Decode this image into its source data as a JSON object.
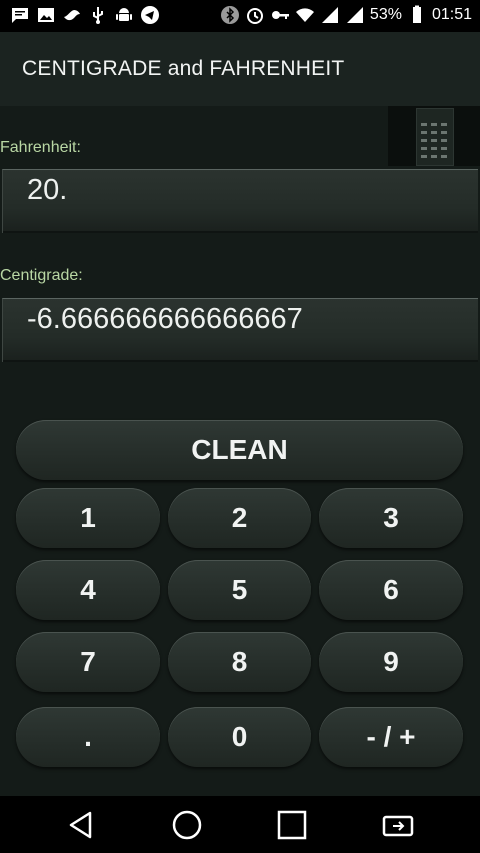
{
  "status_bar": {
    "battery_text": "53%",
    "time": "01:51",
    "left_icons": [
      "message-icon",
      "image-icon",
      "bird-icon",
      "usb-icon",
      "android-icon",
      "telegram-icon"
    ],
    "right_icons": [
      "bluetooth-icon",
      "alarm-icon",
      "key-icon",
      "wifi-icon",
      "signal-icon",
      "signal-icon",
      "battery-icon"
    ]
  },
  "app_bar": {
    "title": "CENTIGRADE and FAHRENHEIT"
  },
  "fahrenheit": {
    "label": "Fahrenheit:",
    "value": "20."
  },
  "centigrade": {
    "label": "Centigrade:",
    "value": "-6.666666666666667"
  },
  "keypad": {
    "clean": "CLEAN",
    "rows": [
      [
        "1",
        "2",
        "3"
      ],
      [
        "4",
        "5",
        "6"
      ],
      [
        "7",
        "8",
        "9"
      ],
      [
        ".",
        "0",
        "- / +"
      ]
    ]
  },
  "nav_bar": {
    "icons": [
      "back-icon",
      "home-icon",
      "recents-icon",
      "screen-rotate-icon"
    ]
  },
  "colors": {
    "background": "#141b18",
    "label_green": "#b9d7a4",
    "button_face": "#2a332f"
  }
}
